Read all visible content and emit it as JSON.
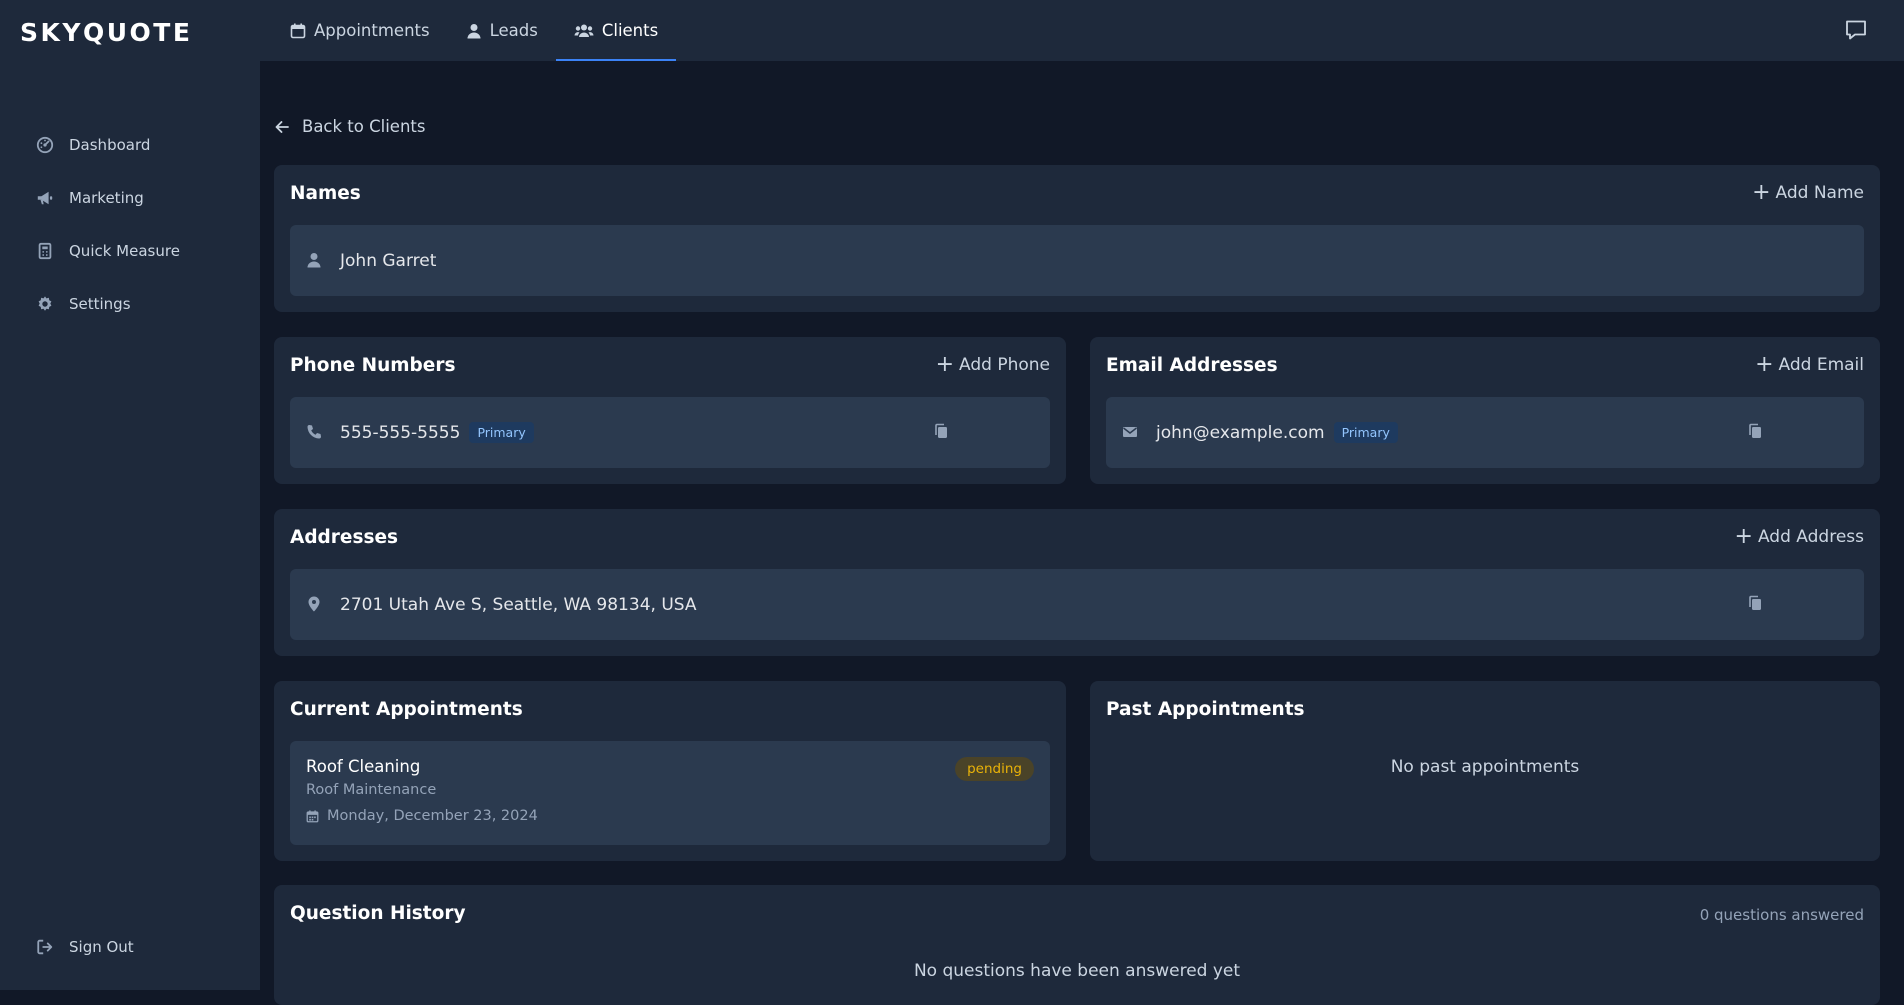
{
  "app": {
    "logo": "SKYQUOTE"
  },
  "topnav": {
    "tabs": [
      {
        "label": "Appointments",
        "icon": "calendar-icon"
      },
      {
        "label": "Leads",
        "icon": "user-icon"
      },
      {
        "label": "Clients",
        "icon": "users-icon",
        "active": true
      }
    ],
    "chat_icon": "chat-icon"
  },
  "sidebar": {
    "items": [
      {
        "label": "Dashboard",
        "icon": "dashboard-icon"
      },
      {
        "label": "Marketing",
        "icon": "megaphone-icon"
      },
      {
        "label": "Quick Measure",
        "icon": "calculator-icon"
      },
      {
        "label": "Settings",
        "icon": "gear-icon"
      }
    ],
    "signout": {
      "label": "Sign Out",
      "icon": "sign-out-icon"
    }
  },
  "back_link": "Back to Clients",
  "names": {
    "title": "Names",
    "action": "Add Name",
    "items": [
      {
        "value": "John Garret"
      }
    ]
  },
  "phones": {
    "title": "Phone Numbers",
    "action": "Add Phone",
    "items": [
      {
        "value": "555-555-5555",
        "badge": "Primary"
      }
    ]
  },
  "emails": {
    "title": "Email Addresses",
    "action": "Add Email",
    "items": [
      {
        "value": "john@example.com",
        "badge": "Primary"
      }
    ]
  },
  "addresses": {
    "title": "Addresses",
    "action": "Add Address",
    "items": [
      {
        "value": "2701 Utah Ave S, Seattle, WA 98134, USA"
      }
    ]
  },
  "current_appointments": {
    "title": "Current Appointments",
    "items": [
      {
        "title": "Roof Cleaning",
        "subtitle": "Roof Maintenance",
        "date": "Monday, December 23, 2024",
        "status": "pending"
      }
    ]
  },
  "past_appointments": {
    "title": "Past Appointments",
    "empty": "No past appointments"
  },
  "question_history": {
    "title": "Question History",
    "count": "0 questions answered",
    "empty": "No questions have been answered yet"
  },
  "colors": {
    "background": "#111827",
    "panel": "#1e293b",
    "row": "#2b3a4f",
    "accent": "#3b82f6",
    "badge_bg": "#1e3a5f",
    "badge_text": "#93c5fd",
    "pending_text": "#eab308"
  }
}
